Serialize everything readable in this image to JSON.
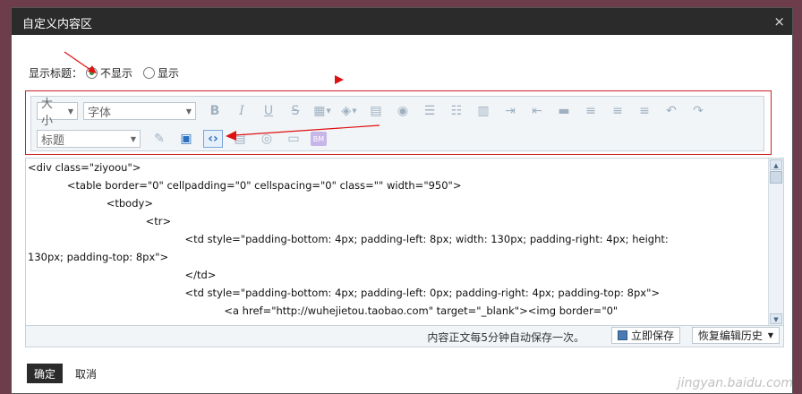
{
  "dialog": {
    "title": "自定义内容区",
    "close_symbol": "×"
  },
  "show_title": {
    "label": "显示标题：",
    "options": [
      {
        "label": "不显示",
        "selected": true
      },
      {
        "label": "显示",
        "selected": false
      }
    ]
  },
  "toolbar": {
    "size_select": "大小",
    "font_select": "字体",
    "heading_select": "标题",
    "bold": "B",
    "italic": "I",
    "underline": "U",
    "strike": "S",
    "insert_text_icon": "BM"
  },
  "editor": {
    "lines": [
      "<div class=\"ziyoou\">",
      "            <table border=\"0\" cellpadding=\"0\" cellspacing=\"0\" class=\"\" width=\"950\">",
      "                        <tbody>",
      "                                    <tr>",
      "                                                <td style=\"padding-bottom: 4px; padding-left: 8px; width: 130px; padding-right: 4px; height:",
      "130px; padding-top: 8px\">",
      "                                                </td>",
      "                                                <td style=\"padding-bottom: 4px; padding-left: 0px; padding-right: 4px; padding-top: 8px\">",
      "                                                            <a href=\"http://wuhejietou.taobao.com\" target=\"_blank\"><img border=\"0\""
    ]
  },
  "statusbar": {
    "autosave_text": "内容正文每5分钟自动保存一次。",
    "save_now_label": "立即保存",
    "restore_history_label": "恢复编辑历史"
  },
  "footer": {
    "confirm_label": "确定",
    "cancel_label": "取消"
  },
  "watermark": "jingyan.baidu.com",
  "colors": {
    "annotation": "#dd1111",
    "titlebar": "#2b2b2b",
    "accent": "#2a6fc0"
  }
}
